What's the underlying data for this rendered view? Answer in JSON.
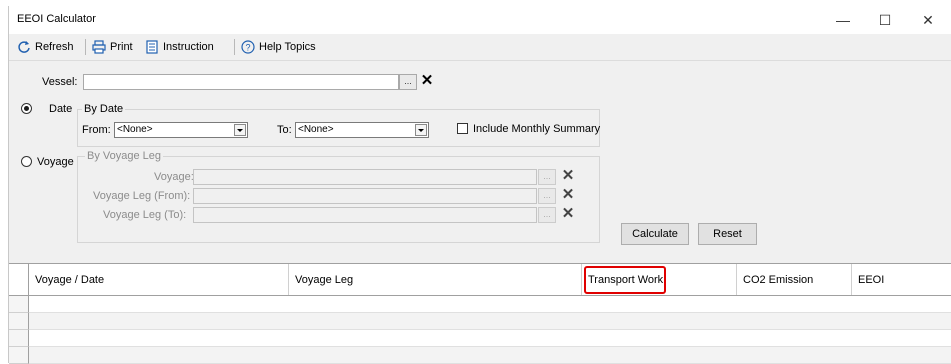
{
  "window": {
    "title": "EEOI Calculator",
    "minimize": "—",
    "maximize": "☐",
    "close": "✕"
  },
  "toolbar": {
    "refresh": "Refresh",
    "print": "Print",
    "instruction": "Instruction",
    "help": "Help Topics"
  },
  "vessel": {
    "label": "Vessel:",
    "browse": "...",
    "clear": "✕"
  },
  "date_mode": {
    "label": "Date",
    "selected": true,
    "group_title": "By Date",
    "from_label": "From:",
    "from_value": "<None>",
    "to_label": "To:",
    "to_value": "<None>",
    "monthly_label": "Include Monthly Summary",
    "monthly_checked": false
  },
  "voyage_mode": {
    "label": "Voyage",
    "selected": false,
    "group_title": "By Voyage Leg",
    "voyage_label": "Voyage:",
    "leg_from_label": "Voyage Leg (From):",
    "leg_to_label": "Voyage Leg (To):",
    "browse": "...",
    "clear": "✕"
  },
  "actions": {
    "calculate": "Calculate",
    "reset": "Reset"
  },
  "grid": {
    "columns": [
      "Voyage / Date",
      "Voyage Leg",
      "Transport Work",
      "CO2 Emission",
      "EEOI"
    ],
    "highlighted_column": "Transport Work"
  },
  "colors": {
    "highlight": "#e00000"
  }
}
